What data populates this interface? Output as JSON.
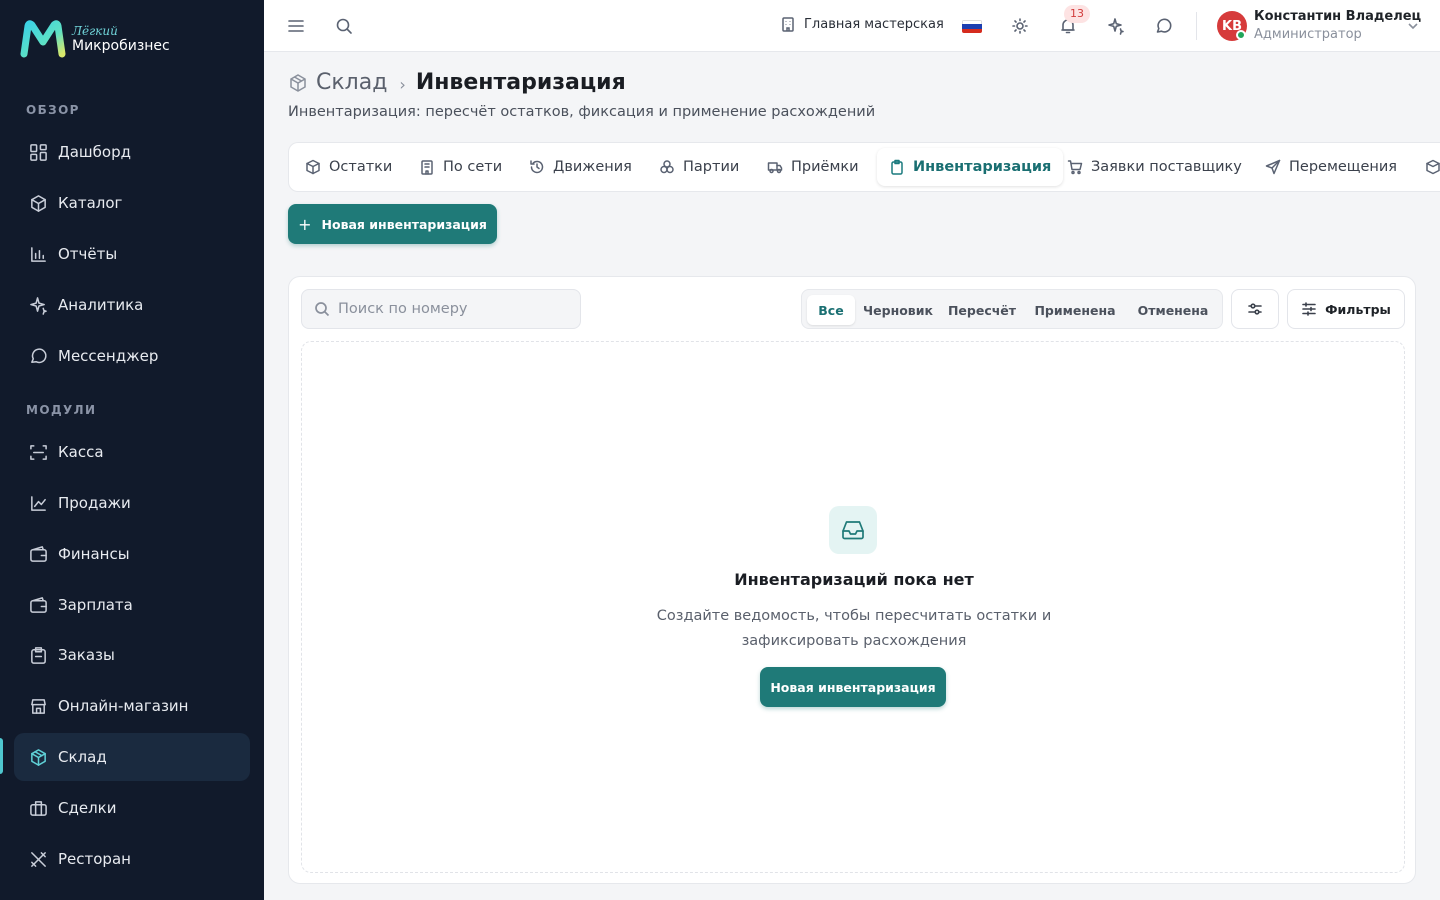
{
  "app": {
    "logo_small": "Лёгкий",
    "logo_big": "Микробизнес",
    "brand_colors": {
      "sidebar_bg": "#111a2b",
      "accent": "#1f7a78",
      "active_text": "#1a6f72"
    }
  },
  "sidebar": {
    "section_overview": "ОБЗОР",
    "overview_items": [
      {
        "label": "Дашборд",
        "icon": "dashboard-icon"
      },
      {
        "label": "Каталог",
        "icon": "catalog-icon"
      },
      {
        "label": "Отчёты",
        "icon": "reports-icon"
      },
      {
        "label": "Аналитика",
        "icon": "sparkle-icon"
      },
      {
        "label": "Мессенджер",
        "icon": "chat-icon"
      }
    ],
    "section_modules": "МОДУЛИ",
    "module_items": [
      {
        "label": "Касса",
        "icon": "scan-icon"
      },
      {
        "label": "Продажи",
        "icon": "chart-line-icon"
      },
      {
        "label": "Финансы",
        "icon": "wallet-icon"
      },
      {
        "label": "Зарплата",
        "icon": "wallet-icon"
      },
      {
        "label": "Заказы",
        "icon": "clipboard-icon"
      },
      {
        "label": "Онлайн-магазин",
        "icon": "store-icon"
      },
      {
        "label": "Склад",
        "icon": "box-icon",
        "active": true
      },
      {
        "label": "Сделки",
        "icon": "briefcase-icon"
      },
      {
        "label": "Ресторан",
        "icon": "utensils-icon"
      }
    ]
  },
  "topbar": {
    "workshop": "Главная мастерская",
    "notifications_count": "13",
    "user_initials": "KB",
    "user_name": "Константин Владелец",
    "user_role": "Администратор"
  },
  "page": {
    "breadcrumb_parent": "Склад",
    "breadcrumb_sep": "›",
    "title": "Инвентаризация",
    "subtitle": "Инвентаризация: пересчёт остатков, фиксация и применение расхождений"
  },
  "tabs": [
    {
      "label": "Остатки",
      "icon": "boxes-icon"
    },
    {
      "label": "По сети",
      "icon": "building-icon"
    },
    {
      "label": "Движения",
      "icon": "history-icon"
    },
    {
      "label": "Партии",
      "icon": "layers-icon"
    },
    {
      "label": "Приёмки",
      "icon": "truck-icon"
    },
    {
      "label": "Инвентаризация",
      "icon": "clipboard-icon",
      "active": true
    },
    {
      "label": "Заявки поставщику",
      "icon": "cart-icon"
    },
    {
      "label": "Перемещения",
      "icon": "send-icon"
    }
  ],
  "actions": {
    "new_plus": "+",
    "new_label": "Новая инвентаризация"
  },
  "filters": {
    "search_placeholder": "Поиск по номеру",
    "statuses": [
      "Все",
      "Черновик",
      "Пересчёт",
      "Применена",
      "Отменена"
    ],
    "active_status": "Все",
    "filters_label": "Фильтры"
  },
  "empty_state": {
    "title": "Инвентаризаций пока нет",
    "description": "Создайте ведомость, чтобы пересчитать остатки и зафиксировать расхождения",
    "button": "Новая инвентаризация"
  }
}
